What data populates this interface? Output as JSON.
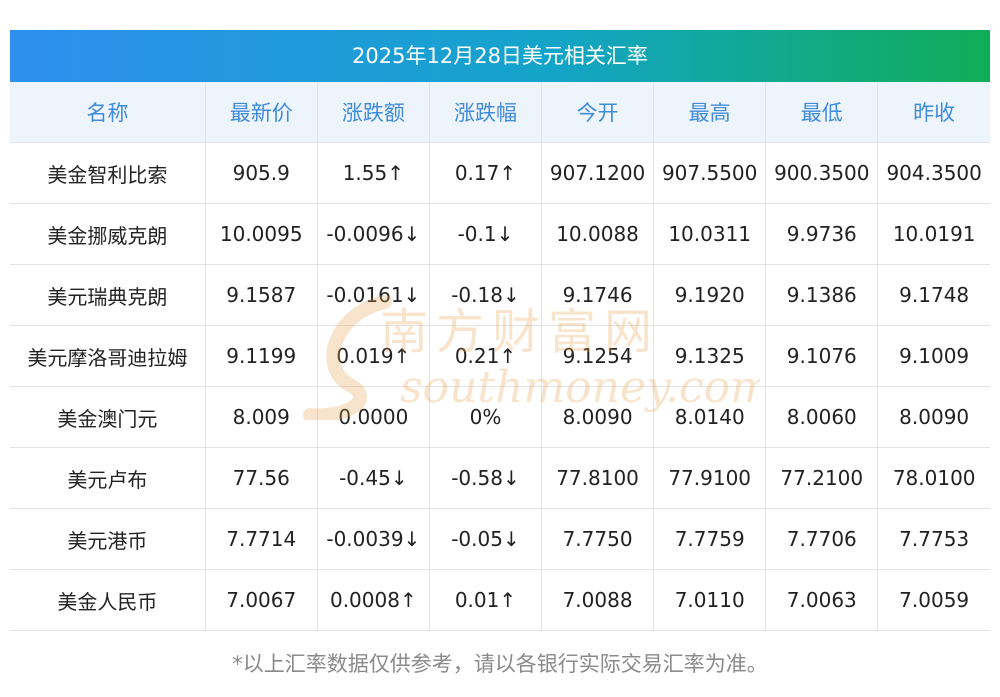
{
  "title": "2025年12月28日美元相关汇率",
  "columns": [
    "名称",
    "最新价",
    "涨跌额",
    "涨跌幅",
    "今开",
    "最高",
    "最低",
    "昨收"
  ],
  "rows": [
    {
      "name": "美金智利比索",
      "latest": "905.9",
      "change": "1.55↑",
      "pct": "0.17↑",
      "open": "907.1200",
      "high": "907.5500",
      "low": "900.3500",
      "prev": "904.3500",
      "trend": "up"
    },
    {
      "name": "美金挪威克朗",
      "latest": "10.0095",
      "change": "-0.0096↓",
      "pct": "-0.1↓",
      "open": "10.0088",
      "high": "10.0311",
      "low": "9.9736",
      "prev": "10.0191",
      "trend": "down"
    },
    {
      "name": "美元瑞典克朗",
      "latest": "9.1587",
      "change": "-0.0161↓",
      "pct": "-0.18↓",
      "open": "9.1746",
      "high": "9.1920",
      "low": "9.1386",
      "prev": "9.1748",
      "trend": "down"
    },
    {
      "name": "美元摩洛哥迪拉姆",
      "latest": "9.1199",
      "change": "0.019↑",
      "pct": "0.21↑",
      "open": "9.1254",
      "high": "9.1325",
      "low": "9.1076",
      "prev": "9.1009",
      "trend": "up"
    },
    {
      "name": "美金澳门元",
      "latest": "8.009",
      "change": "0.0000",
      "pct": "0%",
      "open": "8.0090",
      "high": "8.0140",
      "low": "8.0060",
      "prev": "8.0090",
      "trend": "flat"
    },
    {
      "name": "美元卢布",
      "latest": "77.56",
      "change": "-0.45↓",
      "pct": "-0.58↓",
      "open": "77.8100",
      "high": "77.9100",
      "low": "77.2100",
      "prev": "78.0100",
      "trend": "down"
    },
    {
      "name": "美元港币",
      "latest": "7.7714",
      "change": "-0.0039↓",
      "pct": "-0.05↓",
      "open": "7.7750",
      "high": "7.7759",
      "low": "7.7706",
      "prev": "7.7753",
      "trend": "down"
    },
    {
      "name": "美金人民币",
      "latest": "7.0067",
      "change": "0.0008↑",
      "pct": "0.01↑",
      "open": "7.0088",
      "high": "7.0110",
      "low": "7.0063",
      "prev": "7.0059",
      "trend": "up"
    }
  ],
  "watermark": {
    "cn": "南方财富网",
    "en": "southmoney.com"
  },
  "footnote": "*以上汇率数据仅供参考，请以各银行实际交易汇率为准。",
  "colors": {
    "up": "#e8222a",
    "down": "#1b8a1b",
    "header_text": "#3f8bdc",
    "watermark": "#e9a24a"
  }
}
